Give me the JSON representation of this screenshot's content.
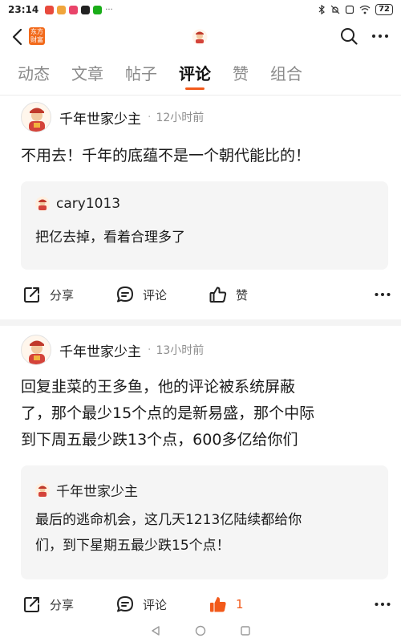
{
  "status_bar": {
    "time": "23:14",
    "battery": "72",
    "app_colors": [
      "#e84a3d",
      "#f0a53c",
      "#e9446a",
      "#222222",
      "#1aad19"
    ]
  },
  "header": {
    "logo_text": "东方财富",
    "back_icon": "chevron-left-icon",
    "search_icon": "search-icon",
    "more_icon": "more-horizontal-icon"
  },
  "tabs": [
    {
      "label": "动态",
      "active": false
    },
    {
      "label": "文章",
      "active": false
    },
    {
      "label": "帖子",
      "active": false
    },
    {
      "label": "评论",
      "active": true
    },
    {
      "label": "赞",
      "active": false
    },
    {
      "label": "组合",
      "active": false
    }
  ],
  "posts": [
    {
      "username": "千年世家少主",
      "time": "12小时前",
      "text": "不用去！千年的底蕴不是一个朝代能比的！",
      "quote": {
        "username": "cary1013",
        "text": "把亿去掉，看着合理多了"
      },
      "actions": {
        "share": "分享",
        "comment": "评论",
        "like": "赞"
      }
    },
    {
      "username": "千年世家少主",
      "time": "13小时前",
      "text_lines": [
        "回复韭菜的王多鱼，他的评论被系统屏蔽",
        "了，那个最少15个点的是新易盛，那个中际",
        "到下周五最少跌13个点，600多亿给你们"
      ],
      "quote": {
        "username": "千年世家少主",
        "text_lines": [
          "最后的逃命机会，这几天1213亿陆续都给你",
          "们，到下星期五最少跌15个点！"
        ]
      },
      "actions": {
        "share": "分享",
        "comment": "评论",
        "like": "1"
      }
    }
  ],
  "colors": {
    "accent": "#f25a1b",
    "quote_bg": "#f5f5f5",
    "muted": "#8e8e8e"
  }
}
